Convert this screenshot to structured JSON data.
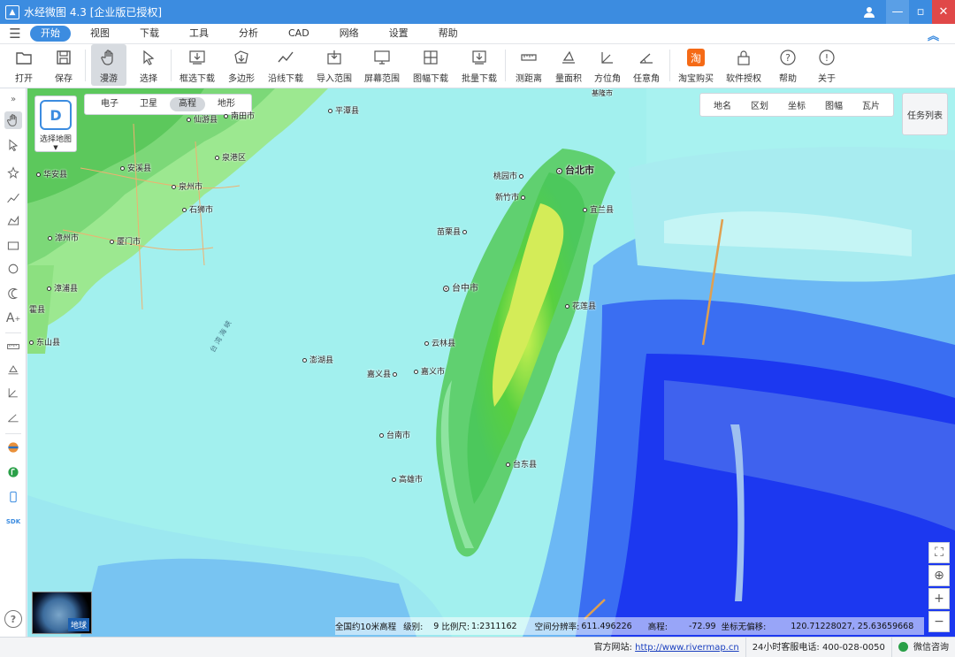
{
  "app": {
    "title": "水经微图 4.3 [企业版已授权]"
  },
  "menu": {
    "items": [
      "开始",
      "视图",
      "下载",
      "工具",
      "分析",
      "CAD",
      "网络",
      "设置",
      "帮助"
    ],
    "active": "开始"
  },
  "toolbar": {
    "items": [
      {
        "label": "打开",
        "icon": "folder-icon"
      },
      {
        "label": "保存",
        "icon": "save-icon"
      },
      {
        "label": "漫游",
        "icon": "hand-icon",
        "active": true
      },
      {
        "label": "选择",
        "icon": "pointer-icon"
      },
      {
        "label": "框选下载",
        "icon": "box-download-icon"
      },
      {
        "label": "多边形",
        "icon": "polygon-download-icon"
      },
      {
        "label": "沿线下载",
        "icon": "line-download-icon"
      },
      {
        "label": "导入范围",
        "icon": "import-icon"
      },
      {
        "label": "屏幕范围",
        "icon": "screen-icon"
      },
      {
        "label": "图幅下载",
        "icon": "grid-download-icon"
      },
      {
        "label": "批量下载",
        "icon": "batch-download-icon"
      },
      {
        "label": "测距离",
        "icon": "ruler-icon"
      },
      {
        "label": "量面积",
        "icon": "area-icon"
      },
      {
        "label": "方位角",
        "icon": "azimuth-icon"
      },
      {
        "label": "任意角",
        "icon": "angle-icon"
      },
      {
        "label": "淘宝购买",
        "icon": "taobao-icon"
      },
      {
        "label": "软件授权",
        "icon": "lock-icon"
      },
      {
        "label": "帮助",
        "icon": "help-icon"
      },
      {
        "label": "关于",
        "icon": "info-icon"
      }
    ]
  },
  "map": {
    "select_map_label": "选择地图",
    "map_types": [
      "电子",
      "卫星",
      "高程",
      "地形"
    ],
    "active_map_type": "高程",
    "overlay_tabs": [
      "地名",
      "区划",
      "坐标",
      "图幅",
      "瓦片"
    ],
    "task_list": "任务列表",
    "globe_label": "地球",
    "places": [
      "平潭县",
      "仙游县",
      "南田市",
      "安溪县",
      "泉港区",
      "华安县",
      "泉州市",
      "石狮市",
      "漳州市",
      "厦门市",
      "漳浦县",
      "霍县",
      "东山县",
      "桃园市",
      "台北市",
      "新竹市",
      "宜兰县",
      "苗栗县",
      "台中市",
      "花莲县",
      "云林县",
      "澎湖县",
      "嘉义县",
      "嘉义市",
      "台南市",
      "台东县",
      "高雄市",
      "基隆市"
    ],
    "strait_label": "台 湾 海 峡"
  },
  "map_status": {
    "dataset": "全国约10米高程",
    "level_label": "级别:",
    "level": "9",
    "scale_label": "比例尺:",
    "scale": "1:2311162",
    "resolution_label": "空间分辨率:",
    "resolution": "611.496226",
    "elevation_label": "高程:",
    "elevation": "-72.99",
    "coord_label": "坐标无偏移:",
    "coord": "120.71228027, 25.63659668"
  },
  "statusbar": {
    "website_label": "官方网站:",
    "website": "http://www.rivermap.cn",
    "phone_label": "24小时客服电话:",
    "phone": "400-028-0050",
    "wechat": "微信咨询"
  }
}
